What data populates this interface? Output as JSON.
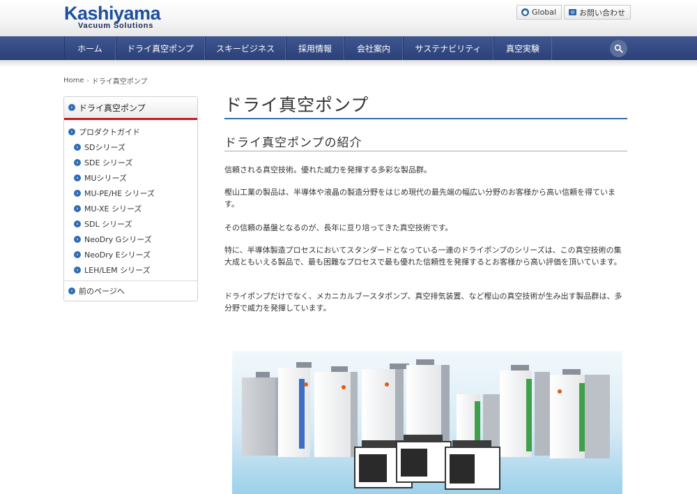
{
  "header": {
    "logo_main": "Kashiyama",
    "logo_sub": "Vacuum Solutions",
    "global_label": "Global",
    "contact_label": "お問い合わせ"
  },
  "nav": {
    "items": [
      "ホーム",
      "ドライ真空ポンプ",
      "スキービジネス",
      "採用情報",
      "会社案内",
      "サステナビリティ",
      "真空実験"
    ]
  },
  "breadcrumb": {
    "home": "Home",
    "separator": "›",
    "current": "ドライ真空ポンプ"
  },
  "sidebar": {
    "heading": "ドライ真空ポンプ",
    "guide": "プロダクトガイド",
    "items": [
      "SDシリーズ",
      "SDE シリーズ",
      "MUシリーズ",
      "MU-PE/HE シリーズ",
      "MU-XE シリーズ",
      "SDL シリーズ",
      "NeoDry Gシリーズ",
      "NeoDry Eシリーズ",
      "LEH/LEM シリーズ"
    ],
    "back": "前のページへ"
  },
  "main": {
    "title": "ドライ真空ポンプ",
    "subtitle": "ドライ真空ポンプの紹介",
    "paragraphs": [
      "信頼される真空技術。優れた威力を発揮する多彩な製品群。",
      "樫山工業の製品は、半導体や液晶の製造分野をはじめ現代の最先端の幅広い分野のお客様から高い信頼を得ています。",
      "その信頼の基盤となるのが、長年に亘り培ってきた真空技術です。",
      "特に、半導体製造プロセスにおいてスタンダードとなっている一連のドライポンプのシリーズは、この真空技術の集大成ともいえる製品で、最も困難なプロセスで最も優れた信頼性を発揮するとお客様から高い評価を頂いています。",
      "ドライポンプだけでなく、メカニカルブースタポンプ、真空排気装置、など樫山の真空技術が生み出す製品群は、多分野で威力を発揮しています。"
    ]
  },
  "colors": {
    "brand_blue": "#1d4fa0",
    "nav_bg": "#34497f",
    "accent_red": "#c8161d",
    "accent_blue": "#2e6bb5"
  }
}
